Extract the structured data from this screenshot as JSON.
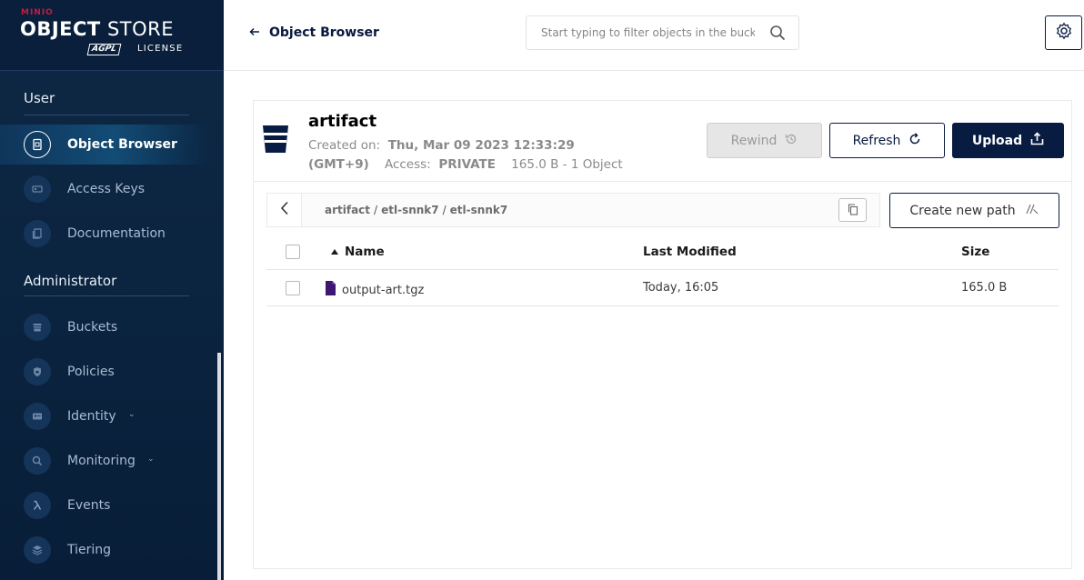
{
  "brand": {
    "minio": "MINIO",
    "store_bold": "OBJECT",
    "store_light": " STORE",
    "agpl": "AGPL",
    "license": "LICENSE"
  },
  "sidebar": {
    "user_section": "User",
    "admin_section": "Administrator",
    "user_items": [
      {
        "label": "Object Browser",
        "icon": "object-browser-icon",
        "active": true
      },
      {
        "label": "Access Keys",
        "icon": "access-keys-icon"
      },
      {
        "label": "Documentation",
        "icon": "documentation-icon"
      }
    ],
    "admin_items": [
      {
        "label": "Buckets",
        "icon": "buckets-icon"
      },
      {
        "label": "Policies",
        "icon": "policies-icon"
      },
      {
        "label": "Identity",
        "icon": "identity-icon",
        "expandable": true
      },
      {
        "label": "Monitoring",
        "icon": "monitoring-icon",
        "expandable": true
      },
      {
        "label": "Events",
        "icon": "lambda-icon"
      },
      {
        "label": "Tiering",
        "icon": "tiering-icon"
      }
    ]
  },
  "topbar": {
    "back_label": "Object Browser",
    "search_placeholder": "Start typing to filter objects in the bucket"
  },
  "bucket": {
    "name": "artifact",
    "created_label": "Created on:",
    "created_value": "Thu, Mar 09 2023 12:33:29",
    "timezone": "(GMT+9)",
    "access_label": "Access:",
    "access_value": "PRIVATE",
    "summary": "165.0 B - 1 Object"
  },
  "actions": {
    "rewind": "Rewind",
    "refresh": "Refresh",
    "upload": "Upload",
    "create_path": "Create new path"
  },
  "breadcrumb": {
    "parts": [
      "artifact",
      "etl-snnk7",
      "etl-snnk7"
    ],
    "separator": "/"
  },
  "table": {
    "columns": {
      "name": "Name",
      "modified": "Last Modified",
      "size": "Size"
    },
    "rows": [
      {
        "name": "output-art.tgz",
        "modified": "Today, 16:05",
        "size": "165.0 B"
      }
    ]
  },
  "colors": {
    "sidebar_bg": "#0b2440",
    "primary": "#081c42",
    "brand_red": "#c51c3f",
    "file_icon": "#3d1573"
  }
}
